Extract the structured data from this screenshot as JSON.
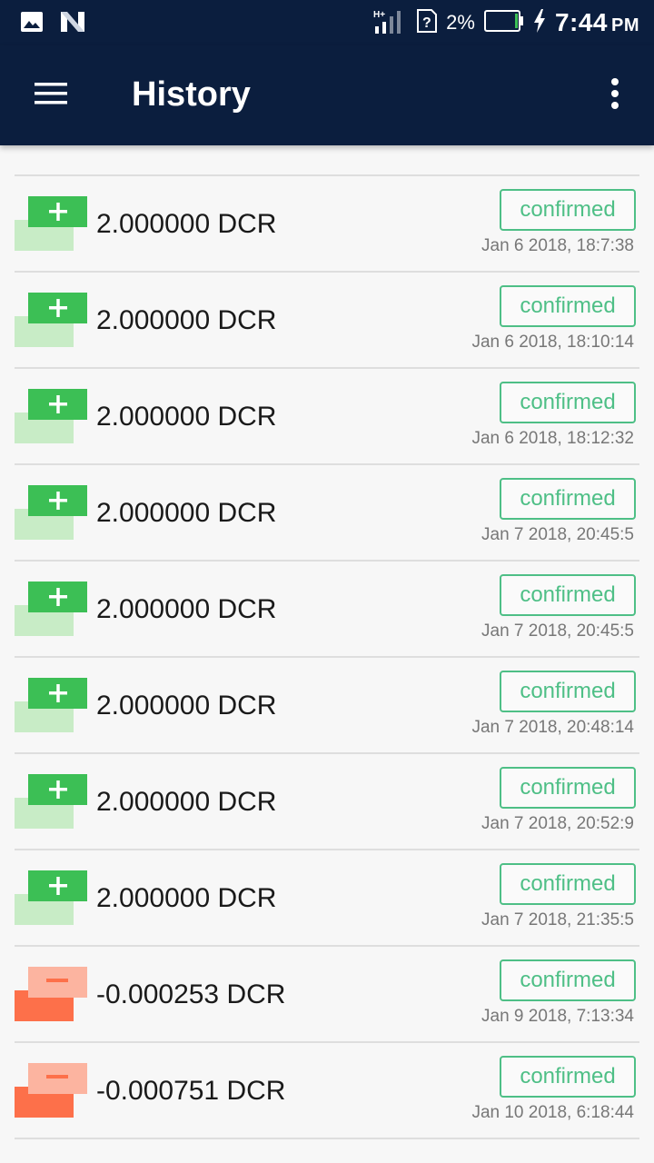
{
  "status_bar": {
    "time": "7:44",
    "ampm": "PM",
    "network": "H+",
    "battery_percent": "2%"
  },
  "app_bar": {
    "title": "History"
  },
  "colors": {
    "appbar": "#0b1e3e",
    "confirmed": "#4ebf86",
    "received_front": "#3cbf55",
    "received_back": "#c8ecc6",
    "sent_front": "#fcb4a0",
    "sent_back": "#fd704a"
  },
  "transactions": [
    {
      "direction": "in",
      "amount": "2.000000 DCR",
      "status": "confirmed",
      "date": "Jan 6 2018, 18:7:38"
    },
    {
      "direction": "in",
      "amount": "2.000000 DCR",
      "status": "confirmed",
      "date": "Jan 6 2018, 18:10:14"
    },
    {
      "direction": "in",
      "amount": "2.000000 DCR",
      "status": "confirmed",
      "date": "Jan 6 2018, 18:12:32"
    },
    {
      "direction": "in",
      "amount": "2.000000 DCR",
      "status": "confirmed",
      "date": "Jan 7 2018, 20:45:5"
    },
    {
      "direction": "in",
      "amount": "2.000000 DCR",
      "status": "confirmed",
      "date": "Jan 7 2018, 20:45:5"
    },
    {
      "direction": "in",
      "amount": "2.000000 DCR",
      "status": "confirmed",
      "date": "Jan 7 2018, 20:48:14"
    },
    {
      "direction": "in",
      "amount": "2.000000 DCR",
      "status": "confirmed",
      "date": "Jan 7 2018, 20:52:9"
    },
    {
      "direction": "in",
      "amount": "2.000000 DCR",
      "status": "confirmed",
      "date": "Jan 7 2018, 21:35:5"
    },
    {
      "direction": "out",
      "amount": "-0.000253 DCR",
      "status": "confirmed",
      "date": "Jan 9 2018, 7:13:34"
    },
    {
      "direction": "out",
      "amount": "-0.000751 DCR",
      "status": "confirmed",
      "date": "Jan 10 2018, 6:18:44"
    }
  ]
}
